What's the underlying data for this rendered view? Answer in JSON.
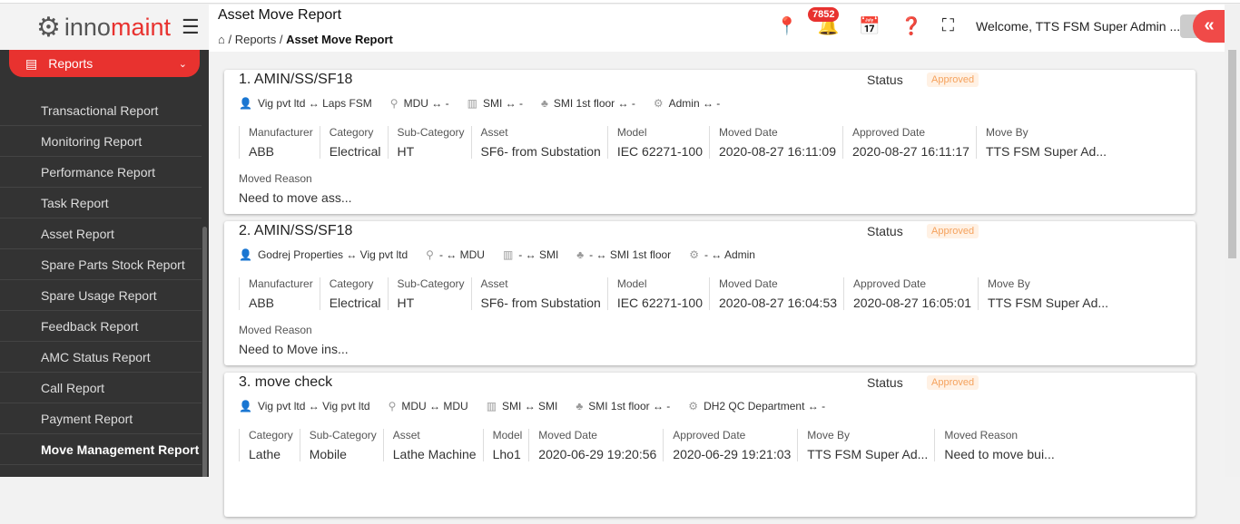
{
  "brand": {
    "part1": "inno",
    "part2": "maint"
  },
  "sidebar": {
    "section": "Reports",
    "items": [
      "Transactional Report",
      "Monitoring Report",
      "Performance Report",
      "Task Report",
      "Asset Report",
      "Spare Parts Stock Report",
      "Spare Usage Report",
      "Feedback Report",
      "AMC Status Report",
      "Call Report",
      "Payment Report",
      "Move Management Report"
    ],
    "active": "Move Management Report"
  },
  "header": {
    "title": "Asset Move Report",
    "breadcrumb": [
      "Reports",
      "Asset Move Report"
    ],
    "notifications": "7852",
    "welcome": "Welcome, TTS FSM Super Admin ..."
  },
  "colors": {
    "accent": "#e8322f",
    "sidebar": "#333333",
    "approved": "#f5a25d"
  },
  "cards": [
    {
      "title": "1. AMIN/SS/SF18",
      "status_label": "Status",
      "status": "Approved",
      "locations": [
        {
          "icon": "user-icon",
          "text": "Vig pvt ltd ↔ Laps FSM"
        },
        {
          "icon": "map-pin-icon",
          "text": "MDU ↔ -"
        },
        {
          "icon": "building-icon",
          "text": "SMI ↔ -"
        },
        {
          "icon": "floor-icon",
          "text": "SMI 1st floor ↔ -"
        },
        {
          "icon": "gear-icon",
          "text": "Admin ↔ -"
        }
      ],
      "fields": [
        {
          "label": "Manufacturer",
          "value": "ABB"
        },
        {
          "label": "Category",
          "value": "Electrical"
        },
        {
          "label": "Sub-Category",
          "value": "HT"
        },
        {
          "label": "Asset",
          "value": "SF6- from Substation"
        },
        {
          "label": "Model",
          "value": "IEC 62271-100"
        },
        {
          "label": "Moved Date",
          "value": "2020-08-27 16:11:09"
        },
        {
          "label": "Approved Date",
          "value": "2020-08-27 16:11:17"
        },
        {
          "label": "Move By",
          "value": "TTS FSM Super Ad..."
        }
      ],
      "reason": {
        "label": "Moved Reason",
        "value": "Need to move ass..."
      }
    },
    {
      "title": "2. AMIN/SS/SF18",
      "status_label": "Status",
      "status": "Approved",
      "locations": [
        {
          "icon": "user-icon",
          "text": "Godrej Properties ↔ Vig pvt ltd"
        },
        {
          "icon": "map-pin-icon",
          "text": "- ↔ MDU"
        },
        {
          "icon": "building-icon",
          "text": "- ↔ SMI"
        },
        {
          "icon": "floor-icon",
          "text": "- ↔ SMI 1st floor"
        },
        {
          "icon": "gear-icon",
          "text": "- ↔ Admin"
        }
      ],
      "fields": [
        {
          "label": "Manufacturer",
          "value": "ABB"
        },
        {
          "label": "Category",
          "value": "Electrical"
        },
        {
          "label": "Sub-Category",
          "value": "HT"
        },
        {
          "label": "Asset",
          "value": "SF6- from Substation"
        },
        {
          "label": "Model",
          "value": "IEC 62271-100"
        },
        {
          "label": "Moved Date",
          "value": "2020-08-27 16:04:53"
        },
        {
          "label": "Approved Date",
          "value": "2020-08-27 16:05:01"
        },
        {
          "label": "Move By",
          "value": "TTS FSM Super Ad..."
        }
      ],
      "reason": {
        "label": "Moved Reason",
        "value": "Need to Move ins..."
      }
    },
    {
      "title": "3. move check",
      "status_label": "Status",
      "status": "Approved",
      "locations": [
        {
          "icon": "user-icon",
          "text": "Vig pvt ltd ↔ Vig pvt ltd"
        },
        {
          "icon": "map-pin-icon",
          "text": "MDU ↔ MDU"
        },
        {
          "icon": "building-icon",
          "text": "SMI ↔ SMI"
        },
        {
          "icon": "floor-icon",
          "text": "SMI 1st floor ↔ -"
        },
        {
          "icon": "gear-icon",
          "text": "DH2 QC Department ↔ -"
        }
      ],
      "fields": [
        {
          "label": "Category",
          "value": "Lathe"
        },
        {
          "label": "Sub-Category",
          "value": "Mobile"
        },
        {
          "label": "Asset",
          "value": "Lathe Machine"
        },
        {
          "label": "Model",
          "value": "Lho1"
        },
        {
          "label": "Moved Date",
          "value": "2020-06-29 19:20:56"
        },
        {
          "label": "Approved Date",
          "value": "2020-06-29 19:21:03"
        },
        {
          "label": "Move By",
          "value": "TTS FSM Super Ad..."
        },
        {
          "label": "Moved Reason",
          "value": "Need to move bui..."
        }
      ]
    }
  ]
}
